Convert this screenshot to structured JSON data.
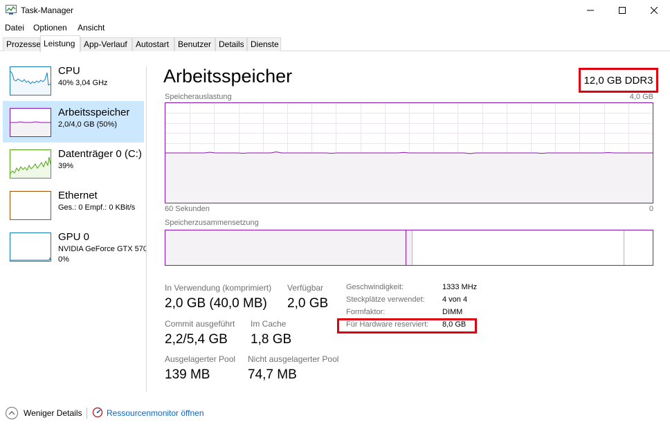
{
  "window": {
    "title": "Task-Manager"
  },
  "menu": [
    "Datei",
    "Optionen",
    "Ansicht"
  ],
  "tabs": [
    "Prozesse",
    "Leistung",
    "App-Verlauf",
    "Autostart",
    "Benutzer",
    "Details",
    "Dienste"
  ],
  "active_tab": "Leistung",
  "sidebar": {
    "items": [
      {
        "name": "CPU",
        "sub": "40%  3,04 GHz",
        "sub2": "",
        "color": "#117dbb"
      },
      {
        "name": "Arbeitsspeicher",
        "sub": "2,0/4,0 GB (50%)",
        "sub2": "",
        "color": "#8b12ae"
      },
      {
        "name": "Datenträger 0 (C:)",
        "sub": "39%",
        "sub2": "",
        "color": "#4da60c"
      },
      {
        "name": "Ethernet",
        "sub": "Ges.: 0  Empf.: 0 KBit/s",
        "sub2": "",
        "color": "#a74f01"
      },
      {
        "name": "GPU 0",
        "sub": "NVIDIA GeForce GTX 570",
        "sub2": "0%",
        "color": "#117dbb"
      }
    ]
  },
  "main": {
    "title": "Arbeitsspeicher",
    "memory_type": "12,0 GB DDR3",
    "usage_label": "Speicherauslastung",
    "usage_max": "4,0 GB",
    "time_span_label": "60 Sekunden",
    "time_end_label": "0",
    "composition_label": "Speicherzusammensetzung",
    "usage_fraction": 0.5
  },
  "stats": {
    "in_use_label": "In Verwendung (komprimiert)",
    "in_use_value": "2,0 GB (40,0 MB)",
    "available_label": "Verfügbar",
    "available_value": "2,0 GB",
    "committed_label": "Commit ausgeführt",
    "committed_value": "2,2/5,4 GB",
    "cached_label": "Im Cache",
    "cached_value": "1,8 GB",
    "paged_label": "Ausgelagerter Pool",
    "paged_value": "139 MB",
    "nonpaged_label": "Nicht ausgelagerter Pool",
    "nonpaged_value": "74,7 MB"
  },
  "specs": [
    {
      "label": "Geschwindigkeit:",
      "value": "1333 MHz"
    },
    {
      "label": "Steckplätze verwendet:",
      "value": "4 von 4"
    },
    {
      "label": "Formfaktor:",
      "value": "DIMM"
    },
    {
      "label": "Für Hardware reserviert:",
      "value": "8,0 GB"
    }
  ],
  "footer": {
    "fewer_details": "Weniger Details",
    "resource_monitor": "Ressourcenmonitor öffnen"
  },
  "colors": {
    "memory": "#8b12ae",
    "highlight": "#e0000f",
    "selected": "#cce8ff",
    "link": "#0066cc"
  },
  "icons": [
    "taskmanager-icon",
    "minimize-icon",
    "maximize-icon",
    "close-icon",
    "chevron-up-icon",
    "resource-monitor-icon"
  ]
}
